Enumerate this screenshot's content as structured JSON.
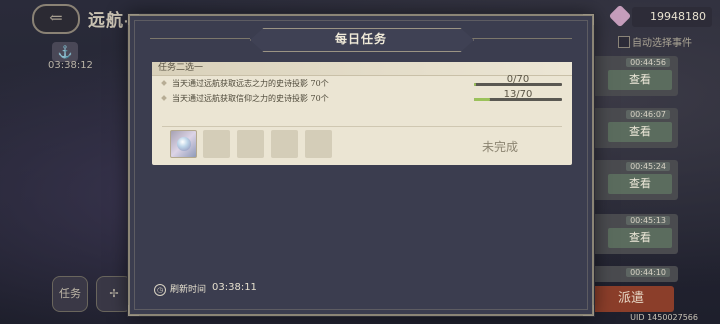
{
  "background": {
    "screen_title": "远航-",
    "side_time": "03:38:12",
    "currency_amount": "19948180",
    "auto_select_label": "自动选择事件",
    "right_list": [
      {
        "time": "00:44:56",
        "view_label": "查看"
      },
      {
        "time": "00:46:07",
        "view_label": "查看"
      },
      {
        "time": "00:45:24",
        "view_label": "查看"
      },
      {
        "time": "00:45:13",
        "view_label": "查看"
      },
      {
        "time": "00:44:10",
        "view_label": ""
      }
    ],
    "dispatch_label": "派遣",
    "uid_text": "UID 1450027566",
    "bottom_icons": [
      "任务",
      ""
    ]
  },
  "dialog": {
    "title": "每日任务",
    "section_label": "任务二选一",
    "tasks": [
      {
        "text": "当天通过远航获取远志之力的史诗投影 70个",
        "progress": "0/70",
        "fraction": 0.02
      },
      {
        "text": "当天通过远航获取信仰之力的史诗投影 70个",
        "progress": "13/70",
        "fraction": 0.186
      }
    ],
    "status": "未完成",
    "refresh_label": "刷新时间",
    "refresh_time": "03:38:11"
  },
  "colors": {
    "dialog_bg": "#3b3d4f",
    "card_bg": "#ebe5d3",
    "progress_fill": "#9bc25a",
    "dispatch_button": "#8b3e2a"
  }
}
